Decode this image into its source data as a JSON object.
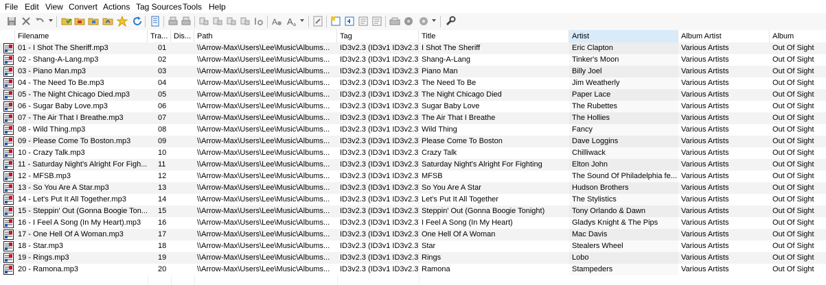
{
  "menu": [
    "File",
    "Edit",
    "View",
    "Convert",
    "Actions",
    "Tag Sources",
    "Tools",
    "Help"
  ],
  "toolbar": {
    "icons": [
      "save-icon",
      "delete-icon",
      "undo-icon",
      "change-directory-icon",
      "open-directory-icon",
      "add-directory-icon",
      "save-playlist-icon",
      "favorites-star-icon",
      "refresh-icon",
      "tag-panel-icon",
      "print-icon",
      "print-preview-icon",
      "tag-to-filename-icon",
      "filename-to-tag-icon",
      "tag-to-tag-icon",
      "text-file-to-tag-icon",
      "autonumbering-icon",
      "case-conversion-icon",
      "actions-icon",
      "export-icon",
      "lyrics-icon",
      "online-lookup-icon",
      "cover-icon",
      "amazon-icon",
      "freedb-icon",
      "discogs-icon",
      "options-icon"
    ]
  },
  "columns": {
    "filename": "Filename",
    "track": "Tra...",
    "disc": "Dis...",
    "path": "Path",
    "tag": "Tag",
    "title": "Title",
    "artist": "Artist",
    "album_artist": "Album Artist",
    "album": "Album"
  },
  "colors": {
    "sorted_header": "#d9ebf9",
    "alt_row": "#f3f3f3"
  },
  "rows": [
    {
      "filename": "01 - I Shot The Sheriff.mp3",
      "track": "01",
      "disc": "",
      "path": "\\\\Arrow-Max\\Users\\Lee\\Music\\Albums...",
      "tag": "ID3v2.3 (ID3v1 ID3v2.3)",
      "title": "I Shot The Sheriff",
      "artist": "Eric Clapton",
      "album_artist": "Various Artists",
      "album": "Out Of Sight"
    },
    {
      "filename": "02 - Shang-A-Lang.mp3",
      "track": "02",
      "disc": "",
      "path": "\\\\Arrow-Max\\Users\\Lee\\Music\\Albums...",
      "tag": "ID3v2.3 (ID3v1 ID3v2.3)",
      "title": "Shang-A-Lang",
      "artist": "Tinker's Moon",
      "album_artist": "Various Artists",
      "album": "Out Of Sight"
    },
    {
      "filename": "03 - Piano Man.mp3",
      "track": "03",
      "disc": "",
      "path": "\\\\Arrow-Max\\Users\\Lee\\Music\\Albums...",
      "tag": "ID3v2.3 (ID3v1 ID3v2.3)",
      "title": "Piano Man",
      "artist": "Billy Joel",
      "album_artist": "Various Artists",
      "album": "Out Of Sight"
    },
    {
      "filename": "04 - The Need To Be.mp3",
      "track": "04",
      "disc": "",
      "path": "\\\\Arrow-Max\\Users\\Lee\\Music\\Albums...",
      "tag": "ID3v2.3 (ID3v1 ID3v2.3)",
      "title": "The Need To Be",
      "artist": "Jim Weatherly",
      "album_artist": "Various Artists",
      "album": "Out Of Sight"
    },
    {
      "filename": "05 - The Night Chicago Died.mp3",
      "track": "05",
      "disc": "",
      "path": "\\\\Arrow-Max\\Users\\Lee\\Music\\Albums...",
      "tag": "ID3v2.3 (ID3v1 ID3v2.3)",
      "title": "The Night Chicago Died",
      "artist": "Paper Lace",
      "album_artist": "Various Artists",
      "album": "Out Of Sight"
    },
    {
      "filename": "06 - Sugar Baby Love.mp3",
      "track": "06",
      "disc": "",
      "path": "\\\\Arrow-Max\\Users\\Lee\\Music\\Albums...",
      "tag": "ID3v2.3 (ID3v1 ID3v2.3)",
      "title": "Sugar Baby Love",
      "artist": "The Rubettes",
      "album_artist": "Various Artists",
      "album": "Out Of Sight"
    },
    {
      "filename": "07 - The Air That I Breathe.mp3",
      "track": "07",
      "disc": "",
      "path": "\\\\Arrow-Max\\Users\\Lee\\Music\\Albums...",
      "tag": "ID3v2.3 (ID3v1 ID3v2.3)",
      "title": "The Air That I Breathe",
      "artist": "The Hollies",
      "album_artist": "Various Artists",
      "album": "Out Of Sight"
    },
    {
      "filename": "08 - Wild Thing.mp3",
      "track": "08",
      "disc": "",
      "path": "\\\\Arrow-Max\\Users\\Lee\\Music\\Albums...",
      "tag": "ID3v2.3 (ID3v1 ID3v2.3)",
      "title": "Wild Thing",
      "artist": "Fancy",
      "album_artist": "Various Artists",
      "album": "Out Of Sight"
    },
    {
      "filename": "09 - Please Come To Boston.mp3",
      "track": "09",
      "disc": "",
      "path": "\\\\Arrow-Max\\Users\\Lee\\Music\\Albums...",
      "tag": "ID3v2.3 (ID3v1 ID3v2.3)",
      "title": "Please Come To Boston",
      "artist": "Dave Loggins",
      "album_artist": "Various Artists",
      "album": "Out Of Sight"
    },
    {
      "filename": "10 - Crazy Talk.mp3",
      "track": "10",
      "disc": "",
      "path": "\\\\Arrow-Max\\Users\\Lee\\Music\\Albums...",
      "tag": "ID3v2.3 (ID3v1 ID3v2.3)",
      "title": "Crazy Talk",
      "artist": "Chilliwack",
      "album_artist": "Various Artists",
      "album": "Out Of Sight"
    },
    {
      "filename": "11 - Saturday Night's Alright For Figh...",
      "track": "11",
      "disc": "",
      "path": "\\\\Arrow-Max\\Users\\Lee\\Music\\Albums...",
      "tag": "ID3v2.3 (ID3v1 ID3v2.3)",
      "title": "Saturday Night's Alright For Fighting",
      "artist": "Elton John",
      "album_artist": "Various Artists",
      "album": "Out Of Sight"
    },
    {
      "filename": "12 - MFSB.mp3",
      "track": "12",
      "disc": "",
      "path": "\\\\Arrow-Max\\Users\\Lee\\Music\\Albums...",
      "tag": "ID3v2.3 (ID3v1 ID3v2.3)",
      "title": "MFSB",
      "artist": "The Sound Of Philadelphia fe...",
      "album_artist": "Various Artists",
      "album": "Out Of Sight"
    },
    {
      "filename": "13 - So You Are A Star.mp3",
      "track": "13",
      "disc": "",
      "path": "\\\\Arrow-Max\\Users\\Lee\\Music\\Albums...",
      "tag": "ID3v2.3 (ID3v1 ID3v2.3)",
      "title": "So You Are A Star",
      "artist": "Hudson Brothers",
      "album_artist": "Various Artists",
      "album": "Out Of Sight"
    },
    {
      "filename": "14 - Let's Put It All Together.mp3",
      "track": "14",
      "disc": "",
      "path": "\\\\Arrow-Max\\Users\\Lee\\Music\\Albums...",
      "tag": "ID3v2.3 (ID3v1 ID3v2.3)",
      "title": "Let's Put It All Together",
      "artist": "The Stylistics",
      "album_artist": "Various Artists",
      "album": "Out Of Sight"
    },
    {
      "filename": "15 - Steppin' Out (Gonna Boogie Ton...",
      "track": "15",
      "disc": "",
      "path": "\\\\Arrow-Max\\Users\\Lee\\Music\\Albums...",
      "tag": "ID3v2.3 (ID3v1 ID3v2.3)",
      "title": "Steppin' Out (Gonna Boogie Tonight)",
      "artist": "Tony Orlando & Dawn",
      "album_artist": "Various Artists",
      "album": "Out Of Sight"
    },
    {
      "filename": "16 - I Feel A Song (In My Heart).mp3",
      "track": "16",
      "disc": "",
      "path": "\\\\Arrow-Max\\Users\\Lee\\Music\\Albums...",
      "tag": "ID3v2.3 (ID3v1 ID3v2.3)",
      "title": "I Feel A Song (In My Heart)",
      "artist": "Gladys Knight & The Pips",
      "album_artist": "Various Artists",
      "album": "Out Of Sight"
    },
    {
      "filename": "17 - One Hell Of A Woman.mp3",
      "track": "17",
      "disc": "",
      "path": "\\\\Arrow-Max\\Users\\Lee\\Music\\Albums...",
      "tag": "ID3v2.3 (ID3v1 ID3v2.3)",
      "title": "One Hell Of A Woman",
      "artist": "Mac Davis",
      "album_artist": "Various Artists",
      "album": "Out Of Sight"
    },
    {
      "filename": "18 - Star.mp3",
      "track": "18",
      "disc": "",
      "path": "\\\\Arrow-Max\\Users\\Lee\\Music\\Albums...",
      "tag": "ID3v2.3 (ID3v1 ID3v2.3)",
      "title": "Star",
      "artist": "Stealers Wheel",
      "album_artist": "Various Artists",
      "album": "Out Of Sight"
    },
    {
      "filename": "19 - Rings.mp3",
      "track": "19",
      "disc": "",
      "path": "\\\\Arrow-Max\\Users\\Lee\\Music\\Albums...",
      "tag": "ID3v2.3 (ID3v1 ID3v2.3)",
      "title": "Rings",
      "artist": "Lobo",
      "album_artist": "Various Artists",
      "album": "Out Of Sight"
    },
    {
      "filename": "20 - Ramona.mp3",
      "track": "20",
      "disc": "",
      "path": "\\\\Arrow-Max\\Users\\Lee\\Music\\Albums...",
      "tag": "ID3v2.3 (ID3v1 ID3v2.3)",
      "title": "Ramona",
      "artist": "Stampeders",
      "album_artist": "Various Artists",
      "album": "Out Of Sight"
    }
  ]
}
